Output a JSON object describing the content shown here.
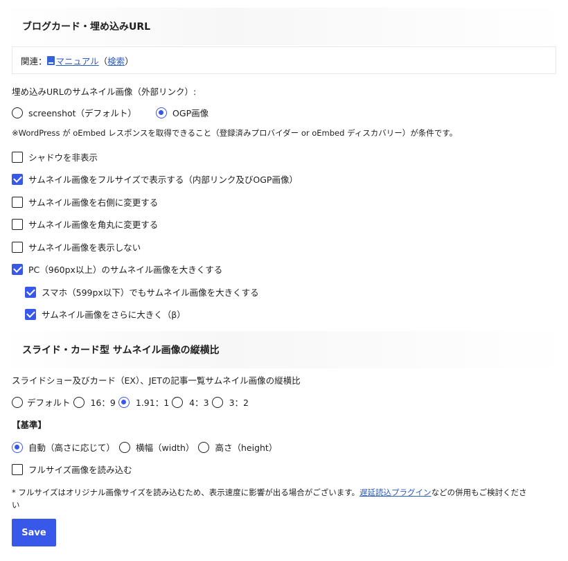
{
  "blogcard": {
    "title": "ブログカード・埋め込みURL",
    "related_label": "関連：",
    "manual_link": "マニュアル",
    "paren_open": "（",
    "search_link": "検索",
    "paren_close": "）",
    "thumb_label": "埋め込みURLのサムネイル画像（外部リンク）:",
    "thumb_options": [
      {
        "label": "screenshot（デフォルト）",
        "selected": false
      },
      {
        "label": "OGP画像",
        "selected": true
      }
    ],
    "note": "※WordPress が oEmbed レスポンスを取得できること（登録済みプロバイダー or oEmbed ディスカバリー）が条件です。",
    "checkboxes": [
      {
        "label": "シャドウを非表示",
        "checked": false
      },
      {
        "label": "サムネイル画像をフルサイズで表示する（内部リンク及びOGP画像）",
        "checked": true
      },
      {
        "label": "サムネイル画像を右側に変更する",
        "checked": false
      },
      {
        "label": "サムネイル画像を角丸に変更する",
        "checked": false
      },
      {
        "label": "サムネイル画像を表示しない",
        "checked": false
      },
      {
        "label": "PC（960px以上）のサムネイル画像を大きくする",
        "checked": true
      }
    ],
    "sub_checkboxes": [
      {
        "label": "スマホ（599px以下）でもサムネイル画像を大きくする",
        "checked": true
      },
      {
        "label": "サムネイル画像をさらに大きく（β）",
        "checked": true
      }
    ]
  },
  "aspect": {
    "title": "スライド・カード型 サムネイル画像の縦横比",
    "label": "スライドショー及びカード（EX）、JETの記事一覧サムネイル画像の縦横比",
    "ratio_options": [
      {
        "label": "デフォルト",
        "selected": false
      },
      {
        "label": "16：9",
        "selected": false
      },
      {
        "label": "1.91：1",
        "selected": true
      },
      {
        "label": "4：3",
        "selected": false
      },
      {
        "label": "3：2",
        "selected": false
      }
    ],
    "basis_label": "【基準】",
    "basis_options": [
      {
        "label": "自動（高さに応じて）",
        "selected": true
      },
      {
        "label": "横幅（width）",
        "selected": false
      },
      {
        "label": "高さ（height）",
        "selected": false
      }
    ],
    "fullsize_label": "フルサイズ画像を読み込む",
    "fullsize_checked": false,
    "note_before": "* フルサイズはオリジナル画像サイズを読み込むため、表示速度に影響が出る場合がございます。",
    "note_link": "遅延読込プラグイン",
    "note_after_line1": "などの併用もご検討くださ",
    "note_after_line2": "い"
  },
  "save_label": "Save",
  "colors": {
    "accent": "#3858e9",
    "link": "#2c5cc5"
  }
}
